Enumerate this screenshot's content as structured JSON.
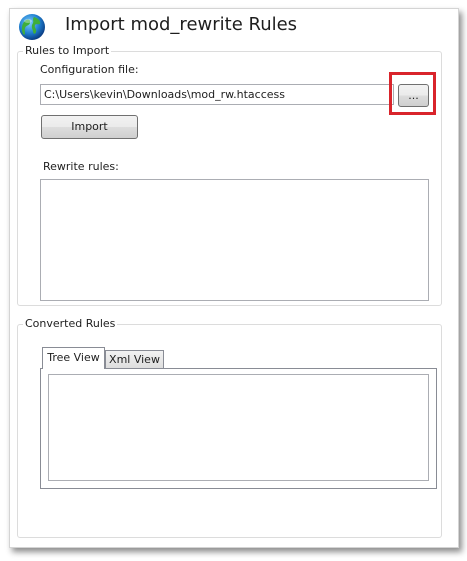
{
  "window": {
    "title": "Import mod_rewrite Rules"
  },
  "rules_to_import": {
    "legend": "Rules to Import",
    "config_label": "Configuration file:",
    "config_value": "C:\\Users\\kevin\\Downloads\\mod_rw.htaccess",
    "browse_label": "...",
    "import_label": "Import",
    "rewrite_label": "Rewrite rules:"
  },
  "converted_rules": {
    "legend": "Converted Rules",
    "tabs": [
      {
        "label": "Tree View",
        "active": true
      },
      {
        "label": "Xml View",
        "active": false
      }
    ]
  },
  "colors": {
    "highlight": "#d9242b"
  },
  "icons": {
    "header": "globe-icon"
  }
}
